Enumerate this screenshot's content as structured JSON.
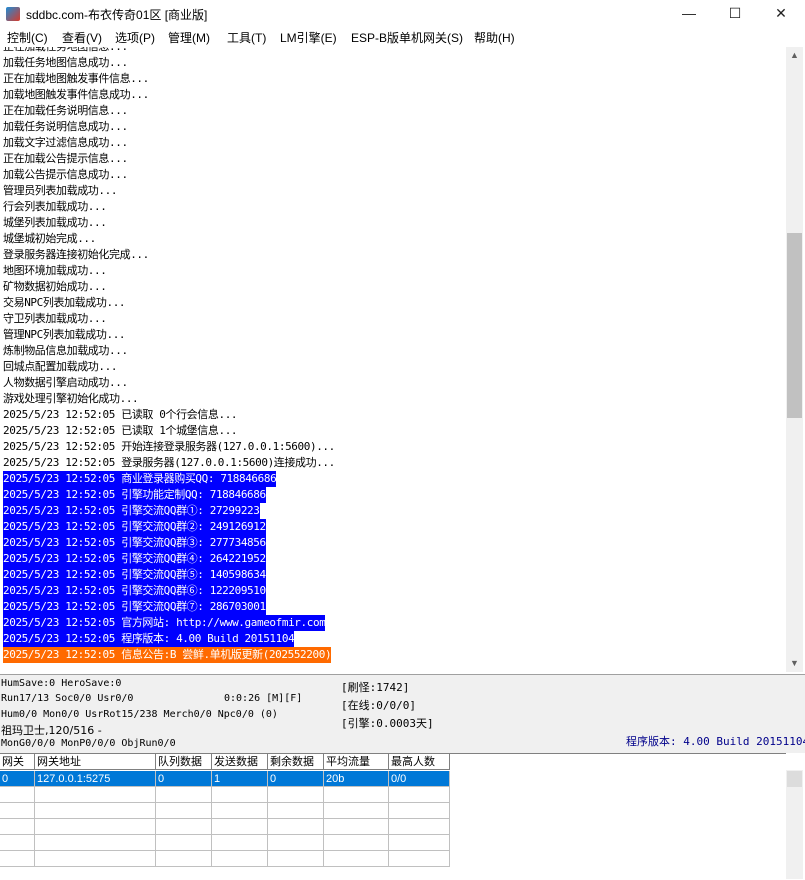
{
  "window": {
    "title": "sddbc.com-布衣传奇01区 [商业版]",
    "minimize": "—",
    "maximize": "☐",
    "close": "✕"
  },
  "menu": [
    "控制(C)",
    "查看(V)",
    "选项(P)",
    "管理(M)",
    "工具(T)",
    "LM引擎(E)",
    "ESP-B版单机网关(S)",
    "帮助(H)"
  ],
  "log": {
    "lines": [
      {
        "text": "正在加载任务地图信息...",
        "style": "partial"
      },
      {
        "text": "加载任务地图信息成功...",
        "style": "normal"
      },
      {
        "text": "正在加载地图触发事件信息...",
        "style": "normal"
      },
      {
        "text": "加载地图触发事件信息成功...",
        "style": "normal"
      },
      {
        "text": "正在加载任务说明信息...",
        "style": "normal"
      },
      {
        "text": "加载任务说明信息成功...",
        "style": "normal"
      },
      {
        "text": "加载文字过滤信息成功...",
        "style": "normal"
      },
      {
        "text": "正在加载公告提示信息...",
        "style": "normal"
      },
      {
        "text": "加载公告提示信息成功...",
        "style": "normal"
      },
      {
        "text": "管理员列表加载成功...",
        "style": "normal"
      },
      {
        "text": "行会列表加载成功...",
        "style": "normal"
      },
      {
        "text": "城堡列表加载成功...",
        "style": "normal"
      },
      {
        "text": "城堡城初始完成...",
        "style": "normal"
      },
      {
        "text": "登录服务器连接初始化完成...",
        "style": "normal"
      },
      {
        "text": "地图环境加载成功...",
        "style": "normal"
      },
      {
        "text": "矿物数据初始成功...",
        "style": "normal"
      },
      {
        "text": "交易NPC列表加载成功...",
        "style": "normal"
      },
      {
        "text": "守卫列表加载成功...",
        "style": "normal"
      },
      {
        "text": "管理NPC列表加载成功...",
        "style": "normal"
      },
      {
        "text": "炼制物品信息加载成功...",
        "style": "normal"
      },
      {
        "text": "回城点配置加载成功...",
        "style": "normal"
      },
      {
        "text": "人物数据引擎启动成功...",
        "style": "normal"
      },
      {
        "text": "游戏处理引擎初始化成功...",
        "style": "normal"
      },
      {
        "text": "2025/5/23 12:52:05 已读取 0个行会信息...",
        "style": "normal"
      },
      {
        "text": "2025/5/23 12:52:05 已读取 1个城堡信息...",
        "style": "normal"
      },
      {
        "text": "2025/5/23 12:52:05 开始连接登录服务器(127.0.0.1:5600)...",
        "style": "normal"
      },
      {
        "text": "2025/5/23 12:52:05 登录服务器(127.0.0.1:5600)连接成功...",
        "style": "normal"
      },
      {
        "text": "2025/5/23 12:52:05 商业登录器购买QQ: 718846686",
        "style": "blue"
      },
      {
        "text": "2025/5/23 12:52:05 引擎功能定制QQ: 718846686",
        "style": "blue"
      },
      {
        "text": "2025/5/23 12:52:05 引擎交流QQ群①: 27299223",
        "style": "blue"
      },
      {
        "text": "2025/5/23 12:52:05 引擎交流QQ群②: 249126912",
        "style": "blue"
      },
      {
        "text": "2025/5/23 12:52:05 引擎交流QQ群③: 277734856",
        "style": "blue"
      },
      {
        "text": "2025/5/23 12:52:05 引擎交流QQ群④: 264221952",
        "style": "blue"
      },
      {
        "text": "2025/5/23 12:52:05 引擎交流QQ群⑤: 140598634",
        "style": "blue"
      },
      {
        "text": "2025/5/23 12:52:05 引擎交流QQ群⑥: 122209510",
        "style": "blue"
      },
      {
        "text": "2025/5/23 12:52:05 引擎交流QQ群⑦: 286703001",
        "style": "blue"
      },
      {
        "text": "2025/5/23 12:52:05 官方网站: http://www.gameofmir.com",
        "style": "blue"
      },
      {
        "text": "2025/5/23 12:52:05 程序版本: 4.00 Build 20151104",
        "style": "blue"
      },
      {
        "text": "2025/5/23 12:52:05 信息公告:B 尝鲜.单机版更新(202552200)",
        "style": "orange"
      }
    ]
  },
  "status": {
    "line1": "HumSave:0 HeroSave:0",
    "line2": "Run17/13 Soc0/0 Usr0/0",
    "runtime": "0:0:26 [M][F]",
    "line3": "Hum0/0 Mon0/0 UsrRot15/238 Merch0/0 Npc0/0 (0)",
    "line4": "祖玛卫士,120/516 -",
    "line5": "MonG0/0/0 MonP0/0/0 ObjRun0/0",
    "refresh": "[刷怪:1742]",
    "online": "[在线:0/0/0]",
    "engine": "[引擎:0.0003天]",
    "version": "程序版本: 4.00 Build 20151104"
  },
  "gateway_table": {
    "columns": [
      "网关",
      "网关地址",
      "队列数据",
      "发送数据",
      "剩余数据",
      "平均流量",
      "最高人数"
    ],
    "rows": [
      [
        "0",
        "127.0.0.1:5275",
        "0",
        "1",
        "0",
        "20b",
        "0/0"
      ]
    ],
    "empty_rows": 5
  },
  "colors": {
    "highlight_blue": "#0000ff",
    "highlight_orange": "#ff6a00",
    "selection": "#0078d7",
    "version_text": "#00008b"
  }
}
